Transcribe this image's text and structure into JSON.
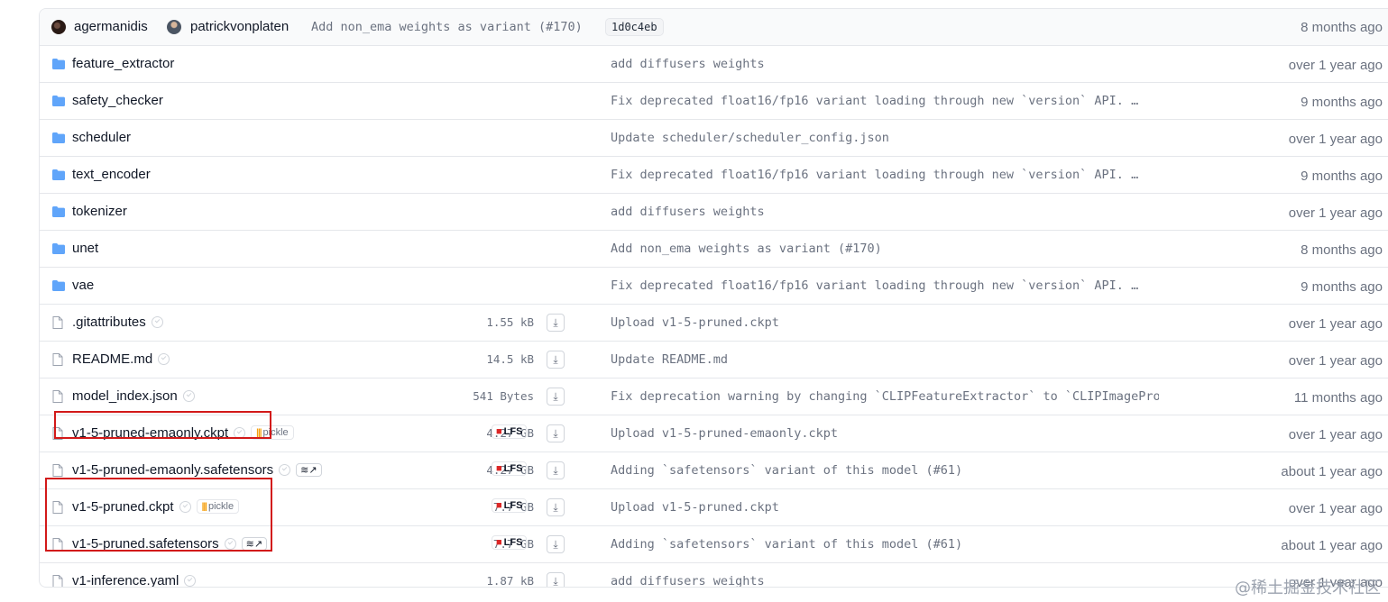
{
  "header": {
    "author1": "agermanidis",
    "author2": "patrickvonplaten",
    "commit_message": "Add non_ema weights as variant (#170)",
    "commit_sha": "1d0c4eb",
    "time": "8 months ago"
  },
  "files": [
    {
      "type": "folder",
      "name": "feature_extractor",
      "size": "",
      "lfs": false,
      "tag": "",
      "commit": "add diffusers weights",
      "time": "over 1 year ago"
    },
    {
      "type": "folder",
      "name": "safety_checker",
      "size": "",
      "lfs": false,
      "tag": "",
      "commit": "Fix deprecated float16/fp16 variant loading through new `version` API. …",
      "time": "9 months ago"
    },
    {
      "type": "folder",
      "name": "scheduler",
      "size": "",
      "lfs": false,
      "tag": "",
      "commit": "Update scheduler/scheduler_config.json",
      "time": "over 1 year ago"
    },
    {
      "type": "folder",
      "name": "text_encoder",
      "size": "",
      "lfs": false,
      "tag": "",
      "commit": "Fix deprecated float16/fp16 variant loading through new `version` API. …",
      "time": "9 months ago"
    },
    {
      "type": "folder",
      "name": "tokenizer",
      "size": "",
      "lfs": false,
      "tag": "",
      "commit": "add diffusers weights",
      "time": "over 1 year ago"
    },
    {
      "type": "folder",
      "name": "unet",
      "size": "",
      "lfs": false,
      "tag": "",
      "commit": "Add non_ema weights as variant (#170)",
      "time": "8 months ago"
    },
    {
      "type": "folder",
      "name": "vae",
      "size": "",
      "lfs": false,
      "tag": "",
      "commit": "Fix deprecated float16/fp16 variant loading through new `version` API. …",
      "time": "9 months ago"
    },
    {
      "type": "file",
      "name": ".gitattributes",
      "size": "1.55 kB",
      "lfs": false,
      "tag": "",
      "commit": "Upload v1-5-pruned.ckpt",
      "time": "over 1 year ago"
    },
    {
      "type": "file",
      "name": "README.md",
      "size": "14.5 kB",
      "lfs": false,
      "tag": "",
      "commit": "Update README.md",
      "time": "over 1 year ago"
    },
    {
      "type": "file",
      "name": "model_index.json",
      "size": "541 Bytes",
      "lfs": false,
      "tag": "",
      "commit": "Fix deprecation warning by changing `CLIPFeatureExtractor` to `CLIPImageProcessor`",
      "time": "11 months ago"
    },
    {
      "type": "file",
      "name": "v1-5-pruned-emaonly.ckpt",
      "size": "4.27 GB",
      "lfs": true,
      "tag": "pickle",
      "commit": "Upload v1-5-pruned-emaonly.ckpt",
      "time": "over 1 year ago"
    },
    {
      "type": "file",
      "name": "v1-5-pruned-emaonly.safetensors",
      "size": "4.27 GB",
      "lfs": true,
      "tag": "safetensors",
      "commit": "Adding `safetensors` variant of this model (#61)",
      "time": "about 1 year ago"
    },
    {
      "type": "file",
      "name": "v1-5-pruned.ckpt",
      "size": "7.7 GB",
      "lfs": true,
      "tag": "pickle",
      "commit": "Upload v1-5-pruned.ckpt",
      "time": "over 1 year ago"
    },
    {
      "type": "file",
      "name": "v1-5-pruned.safetensors",
      "size": "7.7 GB",
      "lfs": true,
      "tag": "safetensors",
      "commit": "Adding `safetensors` variant of this model (#61)",
      "time": "about 1 year ago"
    },
    {
      "type": "file",
      "name": "v1-inference.yaml",
      "size": "1.87 kB",
      "lfs": false,
      "tag": "",
      "commit": "add diffusers weights",
      "time": "over 1 year ago"
    }
  ],
  "labels": {
    "lfs": "LFS",
    "pickle": "pickle",
    "safetensors_arrow": "↗",
    "download": "⤓"
  },
  "watermark": "@稀土掘金技术社区",
  "colors": {
    "folder": "#60a5fa",
    "highlight": "#d21919"
  }
}
